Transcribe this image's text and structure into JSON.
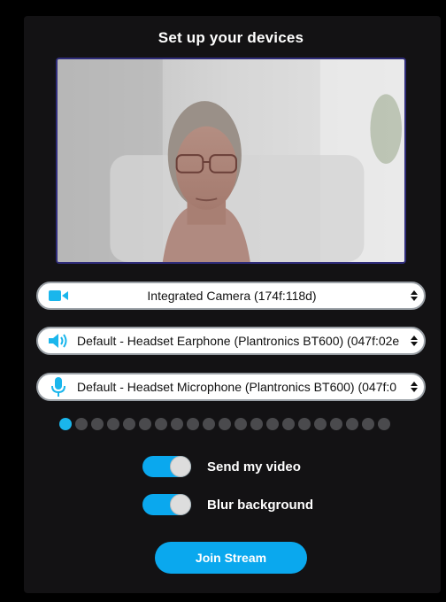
{
  "title": "Set up your devices",
  "camera_select": {
    "value": "Integrated Camera (174f:118d)",
    "icon": "video-camera-icon"
  },
  "speaker_select": {
    "value": "Default - Headset Earphone (Plantronics BT600) (047f:02e",
    "icon": "speaker-icon"
  },
  "mic_select": {
    "value": "Default - Headset Microphone (Plantronics BT600) (047f:0",
    "icon": "microphone-icon"
  },
  "mic_level": {
    "active": 1,
    "total": 21
  },
  "toggles": {
    "send_video": {
      "label": "Send my video",
      "on": true
    },
    "blur": {
      "label": "Blur background",
      "on": true
    }
  },
  "join_button": {
    "label": "Join Stream"
  },
  "colors": {
    "accent": "#0aa8ee",
    "panel": "#131214",
    "meter_on": "#1ab6ec",
    "meter_off": "#4a4a4d"
  }
}
